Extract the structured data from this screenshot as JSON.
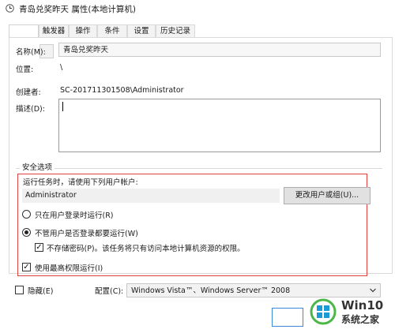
{
  "window": {
    "title": "青岛兑奖昨天 属性(本地计算机)"
  },
  "tabs": [
    {
      "label": "触发器"
    },
    {
      "label": "操作"
    },
    {
      "label": "条件"
    },
    {
      "label": "设置"
    },
    {
      "label": "历史记录"
    }
  ],
  "general": {
    "name_label": "名称(M):",
    "name_value": "青岛兑奖昨天",
    "location_label": "位置:",
    "location_value": "\\",
    "author_label": "创建者:",
    "author_value": "SC-201711301508\\Administrator",
    "description_label": "描述(D):",
    "description_value": ""
  },
  "security": {
    "group_label": "安全选项",
    "run_as_prompt": "运行任务时，请使用下列用户帐户:",
    "account_value": "Administrator",
    "change_user_button": "更改用户或组(U)...",
    "radio_logged_on": "只在用户登录时运行(R)",
    "radio_whether_logged": "不管用户是否登录都要运行(W)",
    "check_no_password": "不存储密码(P)。该任务将只有访问本地计算机资源的权限。",
    "check_highest": "使用最高权限运行(I)"
  },
  "bottom": {
    "hidden_label": "隐藏(E)",
    "configure_label": "配置(C):",
    "configure_value": "Windows Vista™、Windows Server™ 2008"
  },
  "watermark": {
    "brand": "Win10",
    "sub": "系统之家",
    "colors": {
      "green": "#4cb648",
      "blue": "#1a9ad6"
    }
  }
}
